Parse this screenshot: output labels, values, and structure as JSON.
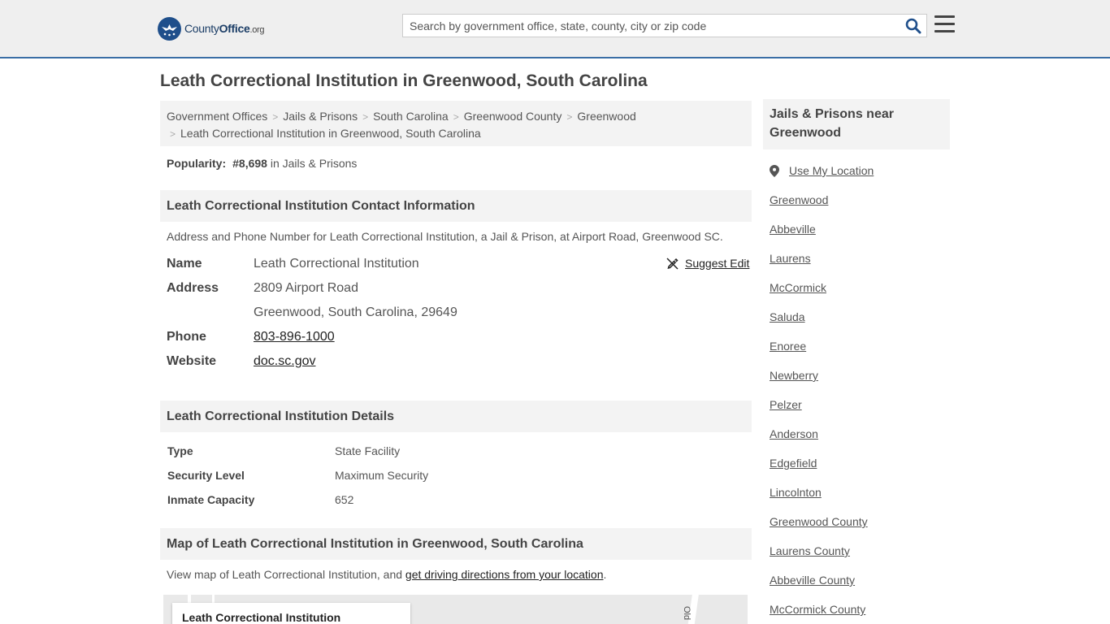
{
  "header": {
    "logo": {
      "name": "County",
      "name_bold": "Office",
      "tld": ".org"
    },
    "search_placeholder": "Search by government office, state, county, city or zip code"
  },
  "page": {
    "title": "Leath Correctional Institution in Greenwood, South Carolina"
  },
  "breadcrumb": {
    "items": [
      "Government Offices",
      "Jails & Prisons",
      "South Carolina",
      "Greenwood County",
      "Greenwood"
    ],
    "current": "Leath Correctional Institution in Greenwood, South Carolina"
  },
  "popularity": {
    "label": "Popularity:",
    "rank": "#8,698",
    "suffix": "in Jails & Prisons"
  },
  "contact": {
    "heading": "Leath Correctional Institution Contact Information",
    "description": "Address and Phone Number for Leath Correctional Institution, a Jail & Prison, at Airport Road, Greenwood SC.",
    "suggest_edit": "Suggest Edit",
    "name_label": "Name",
    "name_value": "Leath Correctional Institution",
    "address_label": "Address",
    "address_line1": "2809 Airport Road",
    "address_line2": "Greenwood, South Carolina, 29649",
    "phone_label": "Phone",
    "phone_value": "803-896-1000",
    "website_label": "Website",
    "website_value": "doc.sc.gov"
  },
  "details": {
    "heading": "Leath Correctional Institution Details",
    "rows": [
      {
        "label": "Type",
        "value": "State Facility"
      },
      {
        "label": "Security Level",
        "value": "Maximum Security"
      },
      {
        "label": "Inmate Capacity",
        "value": "652"
      }
    ]
  },
  "map": {
    "heading": "Map of Leath Correctional Institution in Greenwood, South Carolina",
    "description_prefix": "View map of Leath Correctional Institution, and ",
    "directions_link": "get driving directions from your location",
    "description_suffix": ".",
    "popup_title": "Leath Correctional Institution",
    "road_label": "Old"
  },
  "sidebar": {
    "heading": "Jails & Prisons near Greenwood",
    "use_location": "Use My Location",
    "links": [
      "Greenwood",
      "Abbeville",
      "Laurens",
      "McCormick",
      "Saluda",
      "Enoree",
      "Newberry",
      "Pelzer",
      "Anderson",
      "Edgefield",
      "Lincolnton",
      "Greenwood County",
      "Laurens County",
      "Abbeville County",
      "McCormick County"
    ]
  },
  "colors": {
    "header_bg": "#efefef",
    "header_border": "#3a6ea5",
    "logo_blue": "#1f4f8b",
    "section_bg": "#f3f3f3"
  }
}
